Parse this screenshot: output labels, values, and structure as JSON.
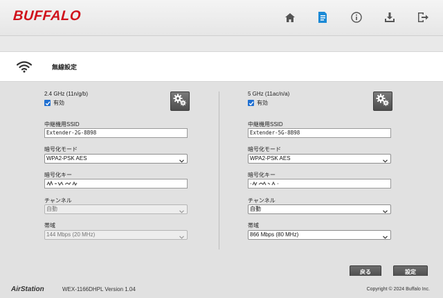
{
  "header": {
    "logo": "BUFFALO",
    "icons": [
      "home-icon",
      "settings-document-icon",
      "info-icon",
      "download-icon",
      "logout-icon"
    ]
  },
  "page": {
    "title": "無線設定"
  },
  "left": {
    "band_title": "2.4 GHz (11n/g/b)",
    "enabled_label": "有効",
    "enabled": true,
    "ssid_label": "中継機用SSID",
    "ssid_value": "Extender-2G-8B98",
    "encryption_label": "暗号化モード",
    "encryption_value": "WPA2-PSK AES",
    "key_label": "暗号化キー",
    "channel_label": "チャンネル",
    "channel_value": "自動",
    "bandwidth_label": "帯域",
    "bandwidth_value": "144 Mbps (20 MHz)"
  },
  "right": {
    "band_title": "5 GHz (11ac/n/a)",
    "enabled_label": "有効",
    "enabled": true,
    "ssid_label": "中継機用SSID",
    "ssid_value": "Extender-5G-8B98",
    "encryption_label": "暗号化モード",
    "encryption_value": "WPA2-PSK AES",
    "key_label": "暗号化キー",
    "channel_label": "チャンネル",
    "channel_value": "自動",
    "bandwidth_label": "帯域",
    "bandwidth_value": "866 Mbps (80 MHz)"
  },
  "buttons": {
    "back": "戻る",
    "apply": "設定"
  },
  "footer": {
    "brand": "AirStation",
    "model_version": "WEX-1166DHPL Version 1.04",
    "copyright": "Copyright © 2024 Buffalo Inc."
  },
  "colors": {
    "logo_red": "#d0111b",
    "checkbox_blue": "#1f6fd1",
    "active_icon_blue": "#1c8ad6",
    "button_dark": "#555555"
  }
}
